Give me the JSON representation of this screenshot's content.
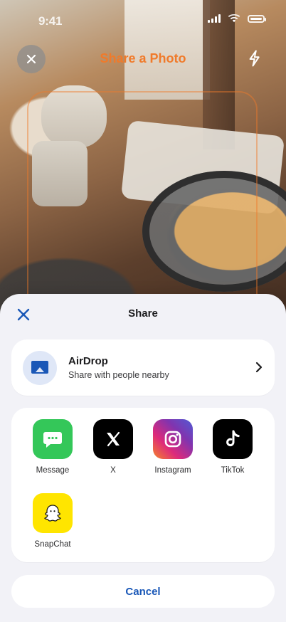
{
  "status_bar": {
    "time": "9:41"
  },
  "camera_header": {
    "title": "Share a Photo",
    "accent": "#f07a2a"
  },
  "share_sheet": {
    "title": "Share",
    "airdrop": {
      "title": "AirDrop",
      "subtitle": "Share with people nearby",
      "icon": "airdrop-icon"
    },
    "apps": [
      {
        "label": "Message",
        "icon": "message-icon",
        "color": "#34c759"
      },
      {
        "label": "X",
        "icon": "x-icon",
        "color": "#000000"
      },
      {
        "label": "Instagram",
        "icon": "instagram-icon",
        "color": "#e1306c"
      },
      {
        "label": "TikTok",
        "icon": "tiktok-icon",
        "color": "#000000"
      },
      {
        "label": "SnapChat",
        "icon": "snapchat-icon",
        "color": "#fffc00"
      }
    ],
    "cancel_label": "Cancel",
    "cancel_color": "#1957b7"
  }
}
